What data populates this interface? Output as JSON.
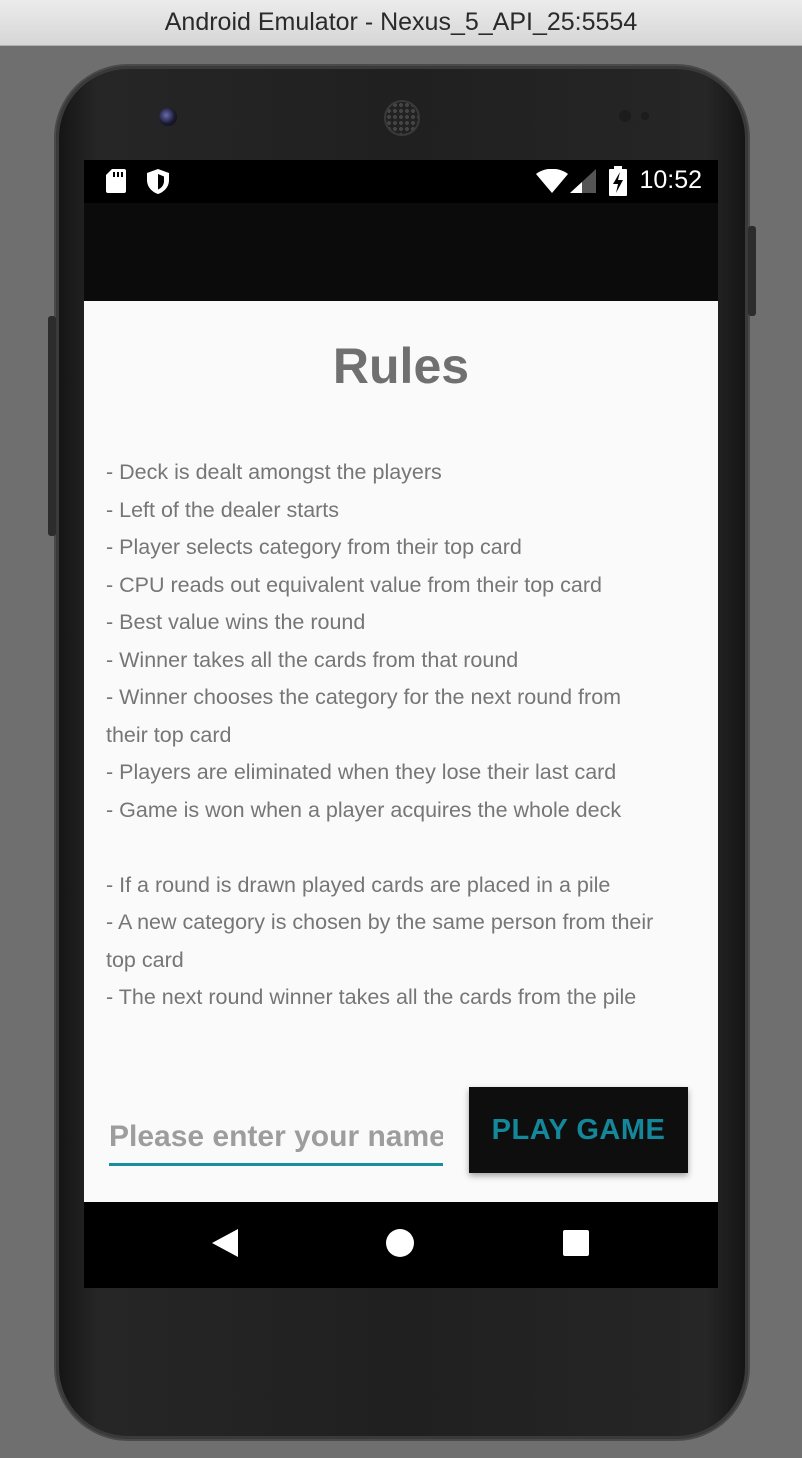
{
  "window": {
    "title": "Android Emulator - Nexus_5_API_25:5554"
  },
  "status_bar": {
    "time": "10:52",
    "icons": [
      "sd-card-icon",
      "shield-icon",
      "wifi-icon",
      "signal-icon",
      "battery-charging-icon"
    ]
  },
  "rules": {
    "title": "Rules",
    "lines": [
      "- Deck is dealt amongst the players",
      "- Left of the dealer starts",
      "- Player selects category from their top card",
      "- CPU reads out equivalent value from their top card",
      "- Best value wins the round",
      "- Winner takes all the cards from that round",
      "- Winner chooses the category for the next round from",
      "their top card",
      "- Players are eliminated when they lose their last card",
      "- Game is won when a player acquires the whole deck",
      "",
      "- If a round is drawn played cards are placed in a pile",
      "- A new category is chosen by the same person from their",
      "top card",
      "- The next round winner takes all the cards from the pile"
    ]
  },
  "form": {
    "name_placeholder": "Please enter your name",
    "name_value": "",
    "play_label": "PLAY GAME"
  },
  "nav_bar": {
    "icons": [
      "back-icon",
      "home-icon",
      "recents-icon"
    ]
  },
  "colors": {
    "accent": "#14889a",
    "app_bar": "#0b0b0b",
    "background": "#fafafa",
    "text": "#767676"
  }
}
